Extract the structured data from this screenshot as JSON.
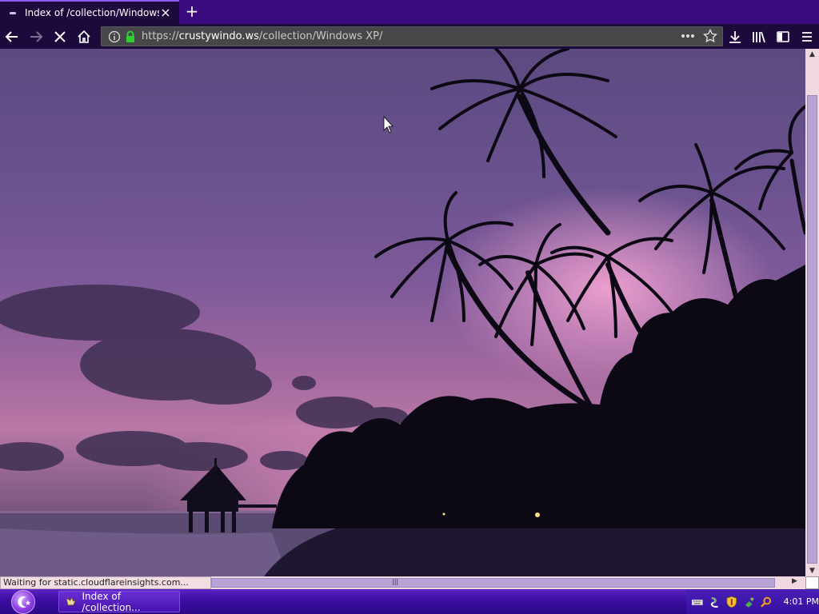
{
  "browser": {
    "tab": {
      "title": "Index of /collection/Windows XP/",
      "close_glyph": "×"
    },
    "new_tab_glyph": "+",
    "address": {
      "scheme": "https://",
      "domain": "crustywindo.ws",
      "path": "/collection/Windows XP/"
    },
    "status_text": "Waiting for static.cloudflareinsights.com...",
    "theme": {
      "tabstrip": "#3a0b7e",
      "toolbar": "#1d0a3d",
      "lock_color": "#2fd12f"
    }
  },
  "taskbar": {
    "task_title": "Index of /collection...",
    "clock": "4:01 PM"
  }
}
